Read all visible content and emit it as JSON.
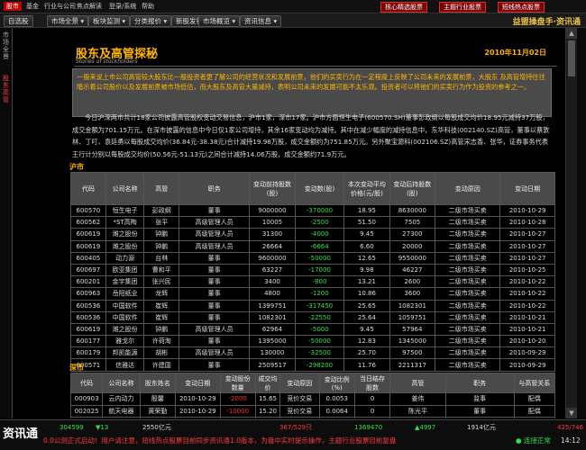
{
  "topbar": {
    "left": [
      "股市",
      "基金",
      "行业与公司",
      "焦点解读",
      "登录/系统",
      "帮助"
    ],
    "right": [
      "核心精选股票",
      "主题行业股票",
      "短线热点股票"
    ]
  },
  "nav": {
    "items": [
      "自选股",
      "市场全景",
      "板块监测",
      "分类报价",
      "新股发行",
      "市场概览",
      "资讯信息"
    ],
    "brand": "益盟操盘手·资讯通"
  },
  "left_strip": {
    "top": "市场全景",
    "active": "股东高管"
  },
  "article": {
    "title": "股东及高管探秘",
    "subtitle": "Stories of stockholders",
    "date": "2010年11月02日",
    "intro": "一般来说上市公司高管较大股东比一般投资者更了解公司的经营状况和发展前景，他们的买卖行为在一定程度上反映了公司未来的发展前景，大股东 及高管增持往往暗示着公司股价以及发展前景被市场低估，而大股东及高管大量减持，表明公司未来的发展可能不太乐观。投资者可以将他们的买卖行为作为投资的参考之一。",
    "para": "今日沪深两市共计18家公司披露高管股权变动交易信息，沪市1家，深市17家。沪市方面恒生电子(600570.SH)董事彭政纲以每股成交均价18.95元减持37万股，成交金额为701.15万元。在深市披露的信息中今日仅1家公司增持，其余16家变动均为减持。其中在减少幅度的减持信息中，东华科技(002140.SZ)高管，董事以蔡敦林、丁叮、袁廷勇以每股成交均价(36.84元-38.38元)合计减持19.98万股，成交金额约为751.85万元。另外聚宝源科(002106.SZ)高管宋志香、张华，证券事务代表王行计分别以每股成交均价(50.56元-51.13元)之间合计减持14.06万股，成交金额约71.9万元。",
    "sh_label": "沪市",
    "sz_label": "深市"
  },
  "sh_table": {
    "headers": [
      "代码",
      "公司名称",
      "高管",
      "职务",
      "变动前持股数(股)",
      "变动数(股)",
      "本次变动平均价格(元/股)",
      "变动后持股数(股)",
      "变动原因",
      "变动日期"
    ],
    "rows": [
      [
        "600570",
        "恒生电子",
        "彭政纲",
        "董事",
        "9000000",
        "-370000",
        "18.95",
        "8630000",
        "二级市场买卖",
        "2010-10-29"
      ],
      [
        "600562",
        "*ST高陶",
        "张平",
        "高级管理人员",
        "10005",
        "-2500",
        "51.50",
        "7505",
        "二级市场买卖",
        "2010-10-28"
      ],
      [
        "600619",
        "潍之股份",
        "钟鹏",
        "高级管理人员",
        "31300",
        "-4000",
        "9.45",
        "27300",
        "二级市场买卖",
        "2010-10-27"
      ],
      [
        "600619",
        "潍之股份",
        "钟鹏",
        "高级管理人员",
        "26664",
        "-6664",
        "6.60",
        "20000",
        "二级市场买卖",
        "2010-10-27"
      ],
      [
        "600405",
        "动力源",
        "台林",
        "董事",
        "9600000",
        "-50000",
        "12.65",
        "9550000",
        "二级市场买卖",
        "2010-10-27"
      ],
      [
        "600697",
        "欧亚集团",
        "曹和平",
        "董事",
        "63227",
        "-17000",
        "9.98",
        "46227",
        "二级市场买卖",
        "2010-10-25"
      ],
      [
        "600201",
        "金宇集团",
        "张兴民",
        "董事",
        "3400",
        "-800",
        "13.21",
        "2600",
        "二级市场买卖",
        "2010-10-22"
      ],
      [
        "600963",
        "岳阳纸业",
        "龙辉",
        "董事",
        "4800",
        "-1200",
        "10.86",
        "3600",
        "二级市场买卖",
        "2010-10-22"
      ],
      [
        "600536",
        "中国软件",
        "崔辉",
        "董事",
        "1399751",
        "-317450",
        "25.65",
        "1082301",
        "二级市场买卖",
        "2010-10-22"
      ],
      [
        "600536",
        "中国软件",
        "崔辉",
        "董事",
        "1082301",
        "-22550",
        "25.64",
        "1059751",
        "二级市场买卖",
        "2010-10-21"
      ],
      [
        "600619",
        "潍之股份",
        "钟鹏",
        "高级管理人员",
        "62964",
        "-5000",
        "9.45",
        "57964",
        "二级市场买卖",
        "2010-10-21"
      ],
      [
        "600177",
        "雅戈尔",
        "许荷淘",
        "董事",
        "1395000",
        "-50000",
        "12.83",
        "1345000",
        "二级市场买卖",
        "2010-10-20"
      ],
      [
        "600179",
        "邦凯能源",
        "胡彬",
        "高级管理人员",
        "130000",
        "-32500",
        "25.70",
        "97500",
        "二级市场买卖",
        "2010-09-29"
      ],
      [
        "600571",
        "信雅达",
        "许建国",
        "董事",
        "2509517",
        "-298200",
        "11.76",
        "2211317",
        "二级市场买卖",
        "2010-09-29"
      ]
    ]
  },
  "sz_table": {
    "headers": [
      "代码",
      "公司名称",
      "股东姓名",
      "变动日期",
      "变动股份数量",
      "成交均价",
      "变动原因",
      "变动比例(%)",
      "当日结存股数",
      "高管",
      "职务",
      "与高管关系"
    ],
    "rows": [
      [
        "000903",
        "云内动力",
        "殷馨",
        "2010-10-29",
        "-2000",
        "15.65",
        "竞价交易",
        "0.0053",
        "0",
        "姜伟",
        "监事",
        "配偶"
      ],
      [
        "002025",
        "航天电器",
        "黄荣勤",
        "2010-10-29",
        "-10000",
        "15.20",
        "竞价交易",
        "0.0064",
        "0",
        "陈光平",
        "董事",
        "配偶"
      ],
      [
        "002080",
        "斯路电气",
        "曹雅君",
        "2010-10-29",
        "-800",
        "26.90",
        "竞价交易",
        "0.0035",
        "0",
        "姚联辉",
        "董事",
        "配偶"
      ],
      [
        "002094",
        "青岛金王",
        "",
        "2010-10-29",
        "-2000",
        "14.80",
        "竞价交易",
        "0.0047",
        "0",
        "",
        "",
        "配偶"
      ]
    ]
  },
  "status": {
    "logo": "资讯通",
    "sh_code": "304599",
    "sh_arrow": "▼13",
    "sh_index": "2550亿元",
    "sz_change": "367/529只",
    "sz_vol": "1369470",
    "sz_arrow": "▲4997",
    "sz_amount": "1914亿元",
    "updown": "425/746",
    "scroll_text": "0.0公测正式启动！用户请注意，短线热点股票目前同步资讯通1.0版本，为盘中实时提示操作，主题行业股票目前复盘",
    "connection": "● 连接正常",
    "time": "14:12"
  }
}
